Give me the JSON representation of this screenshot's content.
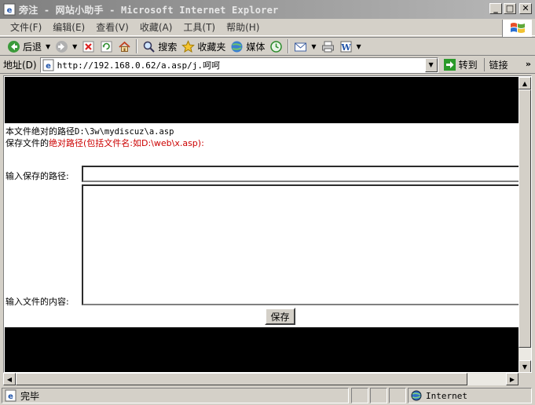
{
  "window": {
    "title": "旁注 - 网站小助手 - Microsoft Internet Explorer",
    "minimize": "_",
    "maximize": "□",
    "close": "✕"
  },
  "menu": {
    "items": [
      "文件(F)",
      "编辑(E)",
      "查看(V)",
      "收藏(A)",
      "工具(T)",
      "帮助(H)"
    ]
  },
  "toolbar": {
    "back": "后退",
    "search": "搜索",
    "favorites": "收藏夹",
    "media": "媒体"
  },
  "address": {
    "label": "地址(D)",
    "url": "http://192.168.0.62/a.asp/j.呵呵",
    "go": "转到",
    "links": "链接",
    "more": "»"
  },
  "page": {
    "abs_path_label": "本文件绝对的路径",
    "abs_path_value": "D:\\3w\\mydiscuz\\a.asp",
    "save_prefix": "保存文件的",
    "save_hint": "绝对路径(包括文件名:如D:\\web\\x.asp):",
    "path_field_label": "输入保存的路径:",
    "path_field_value": "",
    "content_field_label": "输入文件的内容:",
    "content_field_value": "",
    "save_button": "保存"
  },
  "status": {
    "text": "完毕",
    "zone": "Internet"
  },
  "colors": {
    "hint_red": "#cc0000",
    "page_band": "#000000"
  },
  "icons": [
    "ie-page-icon",
    "back-icon",
    "forward-icon",
    "stop-icon",
    "refresh-icon",
    "home-icon",
    "search-icon",
    "favorites-icon",
    "media-icon",
    "history-icon",
    "mail-icon",
    "print-icon",
    "edit-icon",
    "go-arrow-icon",
    "globe-icon",
    "windows-logo-icon"
  ]
}
